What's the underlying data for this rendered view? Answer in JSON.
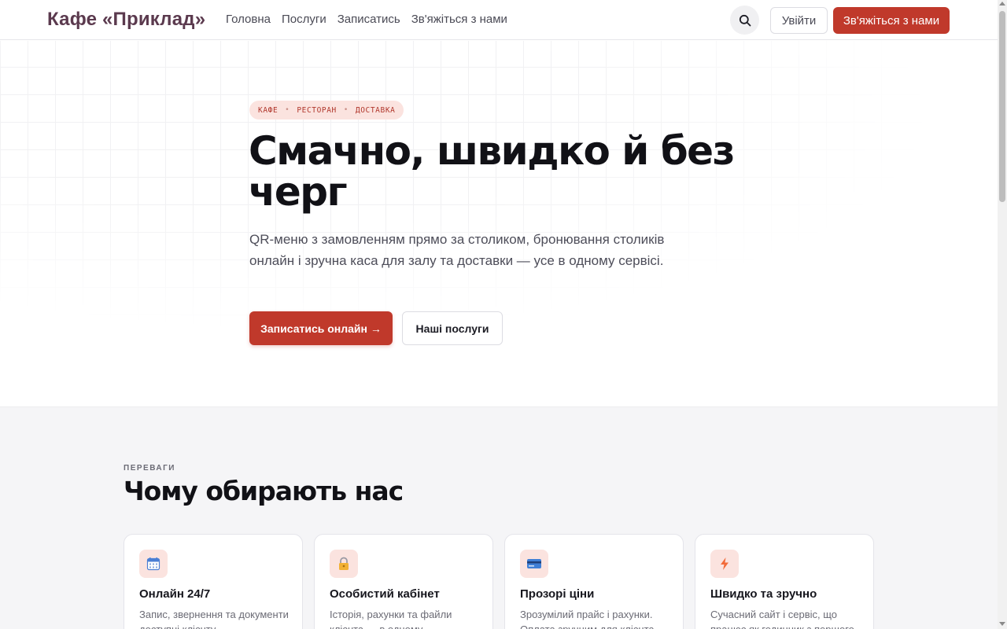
{
  "header": {
    "brand": "Кафе «Приклад»",
    "nav": [
      "Головна",
      "Послуги",
      "Записатись",
      "Зв'яжіться з нами"
    ],
    "login_label": "Увійти",
    "contact_label": "Зв'яжіться з нами",
    "search_icon": "search-icon"
  },
  "hero": {
    "tags": [
      "КАФЕ",
      "РЕСТОРАН",
      "ДОСТАВКА"
    ],
    "title": "Смачно, швидко й без черг",
    "subtitle": "QR-меню з замовленням прямо за столиком, бронювання столиків онлайн і зручна каса для залу та доставки — усе в одному сервісі.",
    "primary_cta": "Записатись онлайн →",
    "secondary_cta": "Наші послуги"
  },
  "features": {
    "eyebrow": "ПЕРЕВАГИ",
    "title": "Чому обирають нас",
    "cards": [
      {
        "icon": "calendar-icon",
        "title": "Онлайн 24/7",
        "desc": "Запис, звернення та документи доступні клієнту"
      },
      {
        "icon": "lock-icon",
        "title": "Особистий кабінет",
        "desc": "Історія, рахунки та файли клієнта — в одному"
      },
      {
        "icon": "credit-card-icon",
        "title": "Прозорі ціни",
        "desc": "Зрозумілий прайс і рахунки. Оплата зручним для клієнта"
      },
      {
        "icon": "lightning-icon",
        "title": "Швидко та зручно",
        "desc": "Сучасний сайт і сервіс, що працює як годинник з першого"
      }
    ]
  },
  "colors": {
    "accent": "#c0392b",
    "brand_text": "#5b3a4e",
    "tag_bg": "#fbe3df",
    "section_bg": "#f5f5f7"
  }
}
